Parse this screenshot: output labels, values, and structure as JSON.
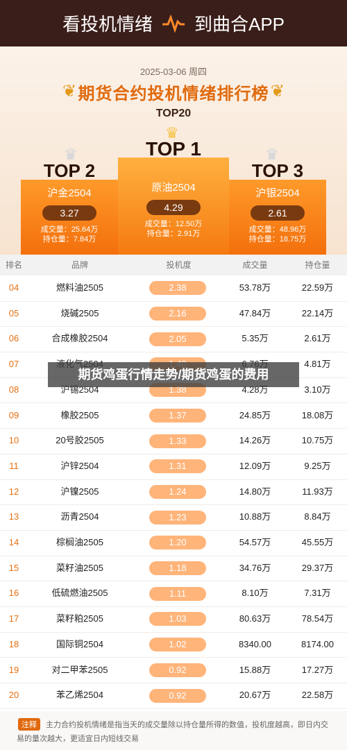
{
  "topbar": {
    "left": "看投机情绪",
    "right": "到曲合APP"
  },
  "hero": {
    "date": "2025-03-06  周四",
    "title": "期货合约投机情绪排行榜",
    "subtitle": "TOP20"
  },
  "top": [
    {
      "rank": "TOP 1",
      "name": "原油2504",
      "score": "4.29",
      "vol": "成交量：12.50万",
      "pos": "持仓量：2.91万"
    },
    {
      "rank": "TOP 2",
      "name": "沪金2504",
      "score": "3.27",
      "vol": "成交量：25.64万",
      "pos": "持仓量：7.84万"
    },
    {
      "rank": "TOP 3",
      "name": "沪银2504",
      "score": "2.61",
      "vol": "成交量：48.96万",
      "pos": "持仓量：18.75万"
    }
  ],
  "table": {
    "headers": [
      "排名",
      "品牌",
      "投机度",
      "成交量",
      "持仓量"
    ],
    "rows": [
      [
        "04",
        "燃料油2505",
        "2.38",
        "53.78万",
        "22.59万"
      ],
      [
        "05",
        "烧碱2505",
        "2.16",
        "47.84万",
        "22.14万"
      ],
      [
        "06",
        "合成橡胶2504",
        "2.05",
        "5.35万",
        "2.61万"
      ],
      [
        "07",
        "液化气2504",
        "1.40",
        "6.76万",
        "4.81万"
      ],
      [
        "08",
        "沪锡2504",
        "1.38",
        "4.28万",
        "3.10万"
      ],
      [
        "09",
        "橡胶2505",
        "1.37",
        "24.85万",
        "18.08万"
      ],
      [
        "10",
        "20号胶2505",
        "1.33",
        "14.26万",
        "10.75万"
      ],
      [
        "11",
        "沪锌2504",
        "1.31",
        "12.09万",
        "9.25万"
      ],
      [
        "12",
        "沪镍2505",
        "1.24",
        "14.80万",
        "11.93万"
      ],
      [
        "13",
        "沥青2504",
        "1.23",
        "10.88万",
        "8.84万"
      ],
      [
        "14",
        "棕榈油2505",
        "1.20",
        "54.57万",
        "45.55万"
      ],
      [
        "15",
        "菜籽油2505",
        "1.18",
        "34.76万",
        "29.37万"
      ],
      [
        "16",
        "低硫燃油2505",
        "1.11",
        "8.10万",
        "7.31万"
      ],
      [
        "17",
        "菜籽粕2505",
        "1.03",
        "80.63万",
        "78.54万"
      ],
      [
        "18",
        "国际铜2504",
        "1.02",
        "8340.00",
        "8174.00"
      ],
      [
        "19",
        "对二甲苯2505",
        "0.92",
        "15.88万",
        "17.27万"
      ],
      [
        "20",
        "苯乙烯2504",
        "0.92",
        "20.67万",
        "22.58万"
      ]
    ]
  },
  "banner": "期货鸡蛋行情走势/期货鸡蛋的费用",
  "note": {
    "tag": "注释",
    "text": "主力合约投机情绪是指当天的成交量除以持仓量所得的数值，投机度越高，即日内交易的量次越大，更适宜日内短线交易"
  }
}
